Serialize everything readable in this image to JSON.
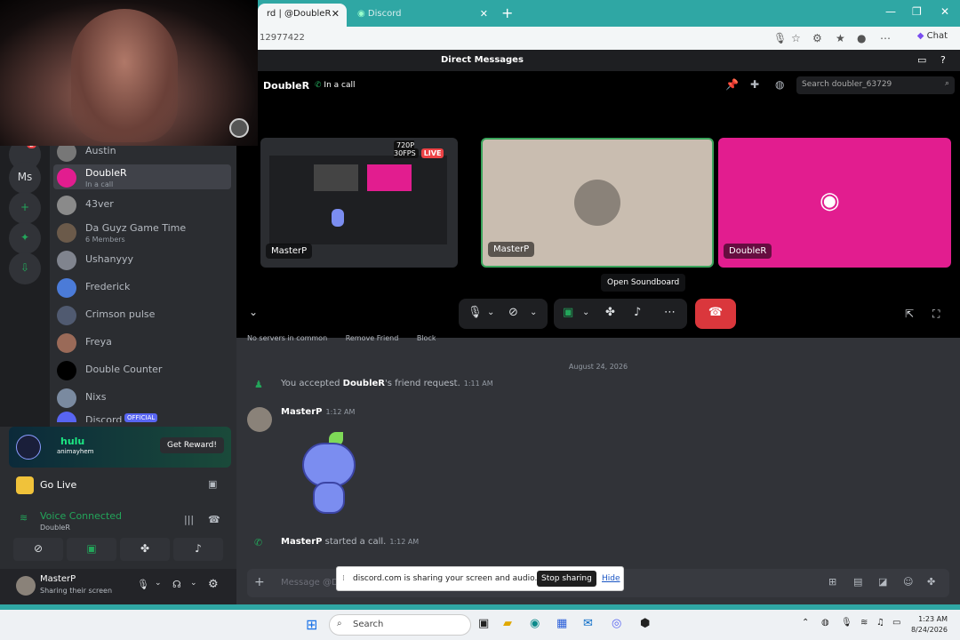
{
  "browser": {
    "tabs": [
      {
        "label": "rd | @DoubleR",
        "active": true
      },
      {
        "label": "Discord",
        "active": false
      }
    ],
    "url": "12977422",
    "chat_label": "Chat"
  },
  "discord_topbar": {
    "title": "Direct Messages"
  },
  "call": {
    "header_name": "DoubleR",
    "header_status": "In a call",
    "search_placeholder": "Search doubler_63729",
    "tiles": [
      {
        "name": "MasterP",
        "badge_res": "720P 30FPS",
        "badge_live": "LIVE"
      },
      {
        "name": "MasterP"
      },
      {
        "name": "DoubleR"
      }
    ],
    "tooltip": "Open Soundboard"
  },
  "sidebar": {
    "guild_badge": "2",
    "guild_ms": "Ms",
    "dms": [
      {
        "name": "Austin",
        "sub": ""
      },
      {
        "name": "DoubleR",
        "sub": "In a call",
        "selected": true
      },
      {
        "name": "43ver",
        "sub": ""
      },
      {
        "name": "Da Guyz Game Time",
        "sub": "6 Members"
      },
      {
        "name": "Ushanyyy",
        "sub": ""
      },
      {
        "name": "Frederick",
        "sub": ""
      },
      {
        "name": "Crimson pulse",
        "sub": ""
      },
      {
        "name": "Freya",
        "sub": ""
      },
      {
        "name": "Double Counter",
        "sub": ""
      },
      {
        "name": "Nixs",
        "sub": ""
      },
      {
        "name": "Discord",
        "sub": "",
        "badge": "OFFICIAL"
      }
    ],
    "promo": {
      "brand": "hulu",
      "tagline": "animayhem",
      "button": "Get Reward!"
    },
    "go_live": "Go Live",
    "voice": {
      "status": "Voice Connected",
      "channel": "DoubleR"
    },
    "user": {
      "name": "MasterP",
      "status": "Sharing their screen"
    }
  },
  "chat": {
    "cut_row": [
      "No servers in common",
      "Remove Friend",
      "Block"
    ],
    "date_divider": "August 24, 2026",
    "messages": [
      {
        "type": "system",
        "pre": "You accepted ",
        "who": "DoubleR",
        "post": "'s friend request.",
        "time": "1:11 AM"
      },
      {
        "type": "user",
        "author": "MasterP",
        "time": "1:12 AM"
      },
      {
        "type": "system",
        "pre": "",
        "who": "MasterP",
        "post": " started a call.",
        "time": "1:12 AM"
      }
    ],
    "input_placeholder": "Message @D"
  },
  "share_bar": {
    "text": "discord.com is sharing your screen and audio.",
    "stop": "Stop sharing",
    "hide": "Hide"
  },
  "taskbar": {
    "search": "Search",
    "time": "1:23 AM",
    "date": "8/24/2026"
  },
  "colors": {
    "accent": "#5865f2",
    "live": "#ed4245",
    "hangup": "#da373c",
    "online": "#23a55a",
    "magenta": "#e21d8f",
    "teal": "#2fa7a4"
  }
}
